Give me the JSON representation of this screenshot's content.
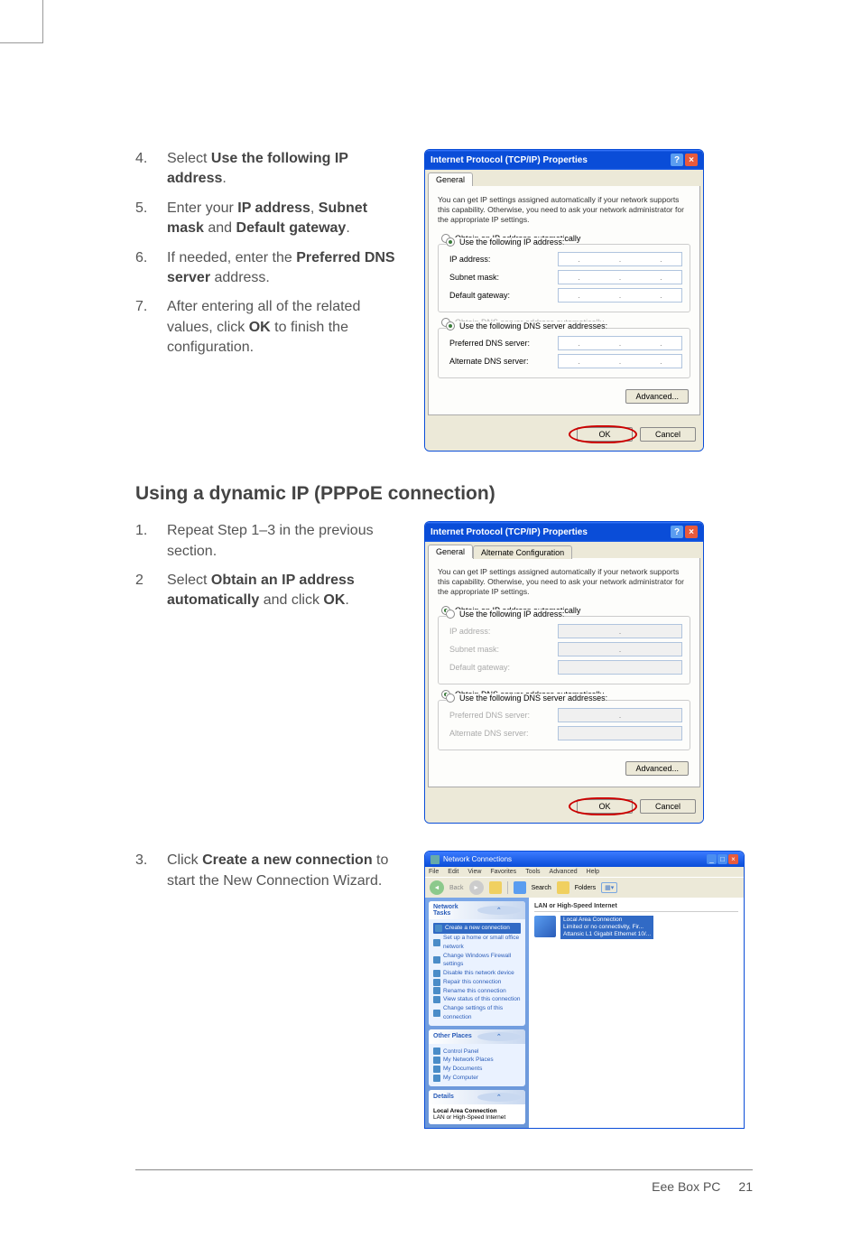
{
  "steps_top": [
    {
      "num": "4.",
      "html": "Select <b>Use the following IP address</b>."
    },
    {
      "num": "5.",
      "html": "Enter your <b>IP address</b>, <b>Subnet mask</b> and <b>Default gateway</b>."
    },
    {
      "num": "6.",
      "html": "If needed, enter the <b>Preferred DNS server</b> address."
    },
    {
      "num": "7.",
      "html": "After entering all of the related values, click <b>OK</b> to finish the configuration."
    }
  ],
  "heading": "Using a dynamic IP (PPPoE connection)",
  "steps_mid": [
    {
      "num": "1.",
      "html": "Repeat Step 1–3 in the previous section."
    },
    {
      "num": "2",
      "html": "Select <b>Obtain an IP address automatically</b> and click <b>OK</b>."
    }
  ],
  "steps_bot": [
    {
      "num": "3.",
      "html": "Click <b>Create a new connection</b> to start the New Connection Wizard."
    }
  ],
  "dialog": {
    "title": "Internet Protocol (TCP/IP) Properties",
    "tab_general": "General",
    "tab_alt": "Alternate Configuration",
    "desc": "You can get IP settings assigned automatically if your network supports this capability. Otherwise, you need to ask your network administrator for the appropriate IP settings.",
    "r1": "Obtain an IP address automatically",
    "r2": "Use the following IP address:",
    "f_ip": "IP address:",
    "f_subnet": "Subnet mask:",
    "f_gateway": "Default gateway:",
    "r3": "Obtain DNS server address automatically",
    "r4": "Use the following DNS server addresses:",
    "f_pdns": "Preferred DNS server:",
    "f_adns": "Alternate DNS server:",
    "btn_adv": "Advanced...",
    "btn_ok": "OK",
    "btn_cancel": "Cancel"
  },
  "nc": {
    "title": "Network Connections",
    "menu": [
      "File",
      "Edit",
      "View",
      "Favorites",
      "Tools",
      "Advanced",
      "Help"
    ],
    "toolbar": {
      "back": "Back",
      "search": "Search",
      "folders": "Folders"
    },
    "panels": {
      "tasks_hdr": "Network Tasks",
      "tasks": [
        "Create a new connection",
        "Set up a home or small office network",
        "Change Windows Firewall settings",
        "Disable this network device",
        "Repair this connection",
        "Rename this connection",
        "View status of this connection",
        "Change settings of this connection"
      ],
      "places_hdr": "Other Places",
      "places": [
        "Control Panel",
        "My Network Places",
        "My Documents",
        "My Computer"
      ],
      "details_hdr": "Details",
      "details_title": "Local Area Connection",
      "details_sub": "LAN or High-Speed Internet"
    },
    "main": {
      "section": "LAN or High-Speed Internet",
      "item_title": "Local Area Connection",
      "item_sub1": "Limited or no connectivity, Fir...",
      "item_sub2": "Attansic L1 Gigabit Ethernet 10/..."
    }
  },
  "footer": {
    "product": "Eee Box PC",
    "page": "21"
  }
}
